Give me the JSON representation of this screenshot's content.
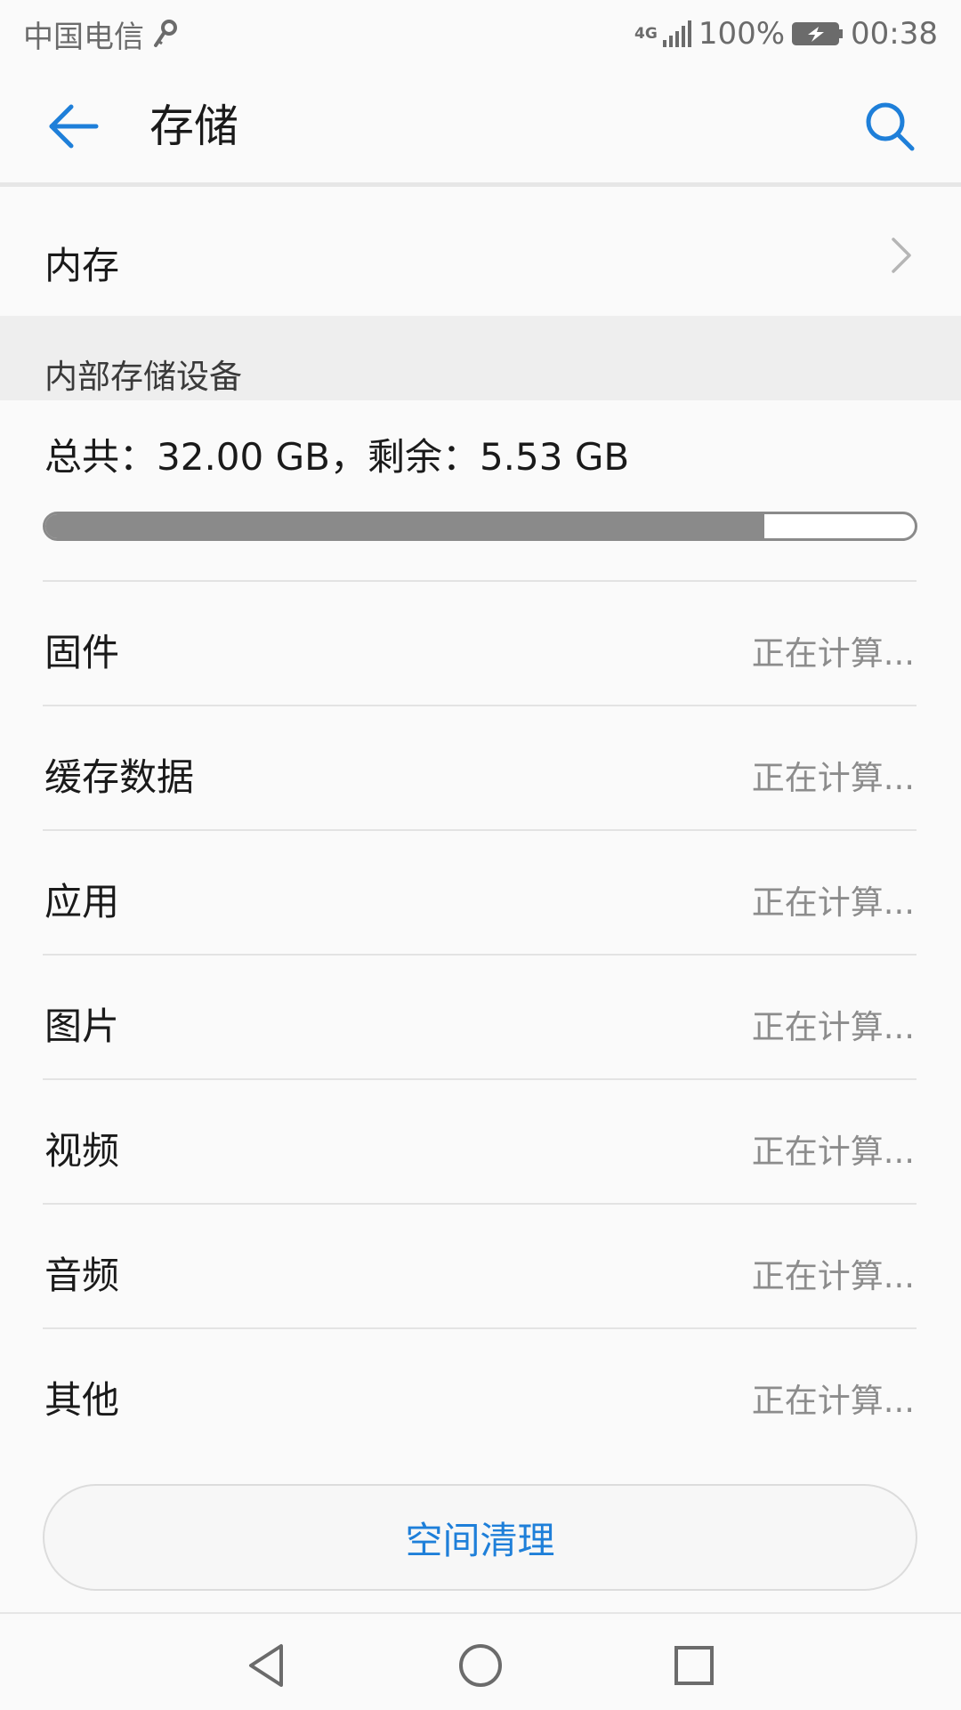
{
  "status_bar": {
    "carrier": "中国电信",
    "network": "4G",
    "battery": "100%",
    "time": "00:38",
    "icons": [
      "key-icon",
      "signal-icon",
      "battery-charging-icon"
    ]
  },
  "header": {
    "title": "存储",
    "back_icon": "arrow-left-icon",
    "search_icon": "search-icon",
    "accent": "#1e7fd9"
  },
  "memory_row": {
    "label": "内存",
    "icon": "chevron-right-icon"
  },
  "section": {
    "title": "内部存储设备"
  },
  "storage": {
    "summary": "总共：32.00 GB，剩余：5.53 GB",
    "used_fraction": 0.827
  },
  "categories": [
    {
      "label": "固件",
      "value": "正在计算..."
    },
    {
      "label": "缓存数据",
      "value": "正在计算..."
    },
    {
      "label": "应用",
      "value": "正在计算..."
    },
    {
      "label": "图片",
      "value": "正在计算..."
    },
    {
      "label": "视频",
      "value": "正在计算..."
    },
    {
      "label": "音频",
      "value": "正在计算..."
    },
    {
      "label": "其他",
      "value": "正在计算..."
    }
  ],
  "clean_button": {
    "label": "空间清理"
  },
  "nav": {
    "icons": [
      "back-triangle-icon",
      "home-circle-icon",
      "recents-square-icon"
    ]
  }
}
